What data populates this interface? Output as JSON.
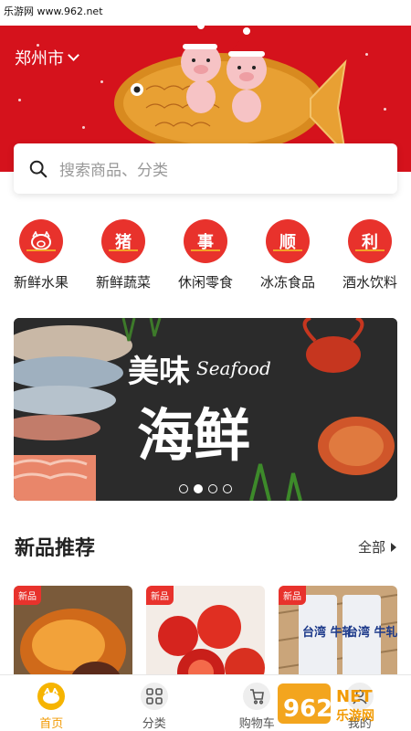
{
  "watermark": "乐游网 www.962.net",
  "header": {
    "city": "郑州市"
  },
  "search": {
    "placeholder": "搜索商品、分类"
  },
  "categories": [
    {
      "glyph": "猪",
      "label": "新鲜水果"
    },
    {
      "glyph": "猪",
      "label": "新鲜蔬菜"
    },
    {
      "glyph": "事",
      "label": "休闲零食"
    },
    {
      "glyph": "顺",
      "label": "冰冻食品"
    },
    {
      "glyph": "利",
      "label": "酒水饮料"
    }
  ],
  "banner": {
    "line1": "美味",
    "script": "Seafood",
    "line2": "海鲜",
    "slide_count": 4,
    "active_slide": 2
  },
  "new_products": {
    "title": "新品推荐",
    "more": "全部"
  },
  "products": [
    {
      "badge": "新品",
      "pack_text": ""
    },
    {
      "badge": "新品",
      "pack_text": ""
    },
    {
      "badge": "新品",
      "pack_text": "台湾 牛轧"
    }
  ],
  "tabbar": [
    {
      "label": "首页",
      "icon": "home-icon",
      "active": true
    },
    {
      "label": "分类",
      "icon": "grid-icon",
      "active": false
    },
    {
      "label": "购物车",
      "icon": "cart-icon",
      "active": false
    },
    {
      "label": "我的",
      "icon": "user-icon",
      "active": false
    }
  ],
  "corner_logo": {
    "big": "962",
    "small": "NET",
    "sub": "乐游网"
  },
  "colors": {
    "hero_red": "#d5121c",
    "category_red": "#e8322c",
    "accent_orange": "#f29b05"
  }
}
